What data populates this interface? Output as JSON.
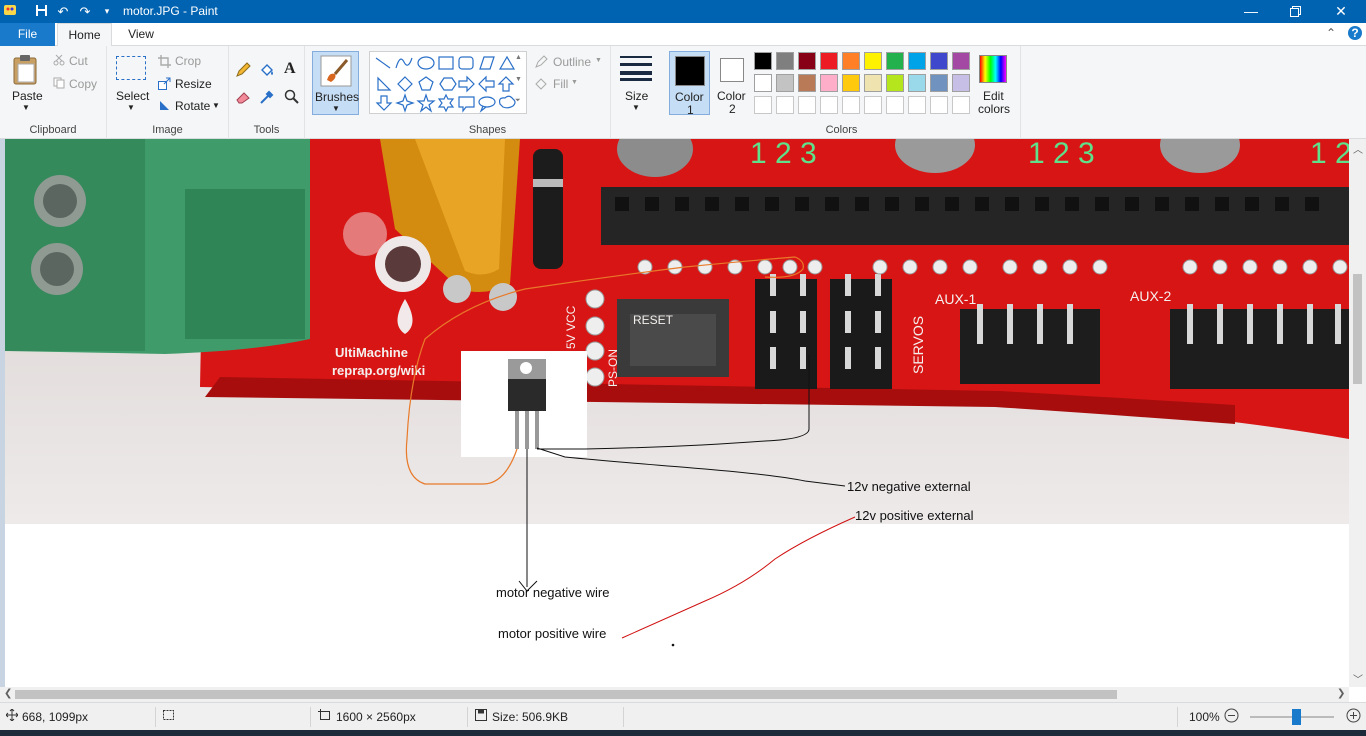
{
  "app": {
    "window_title": "motor.JPG - Paint"
  },
  "quick_access": [
    "save-icon",
    "undo-icon",
    "redo-icon",
    "customize-icon"
  ],
  "tabs": [
    {
      "label": "File"
    },
    {
      "label": "Home"
    },
    {
      "label": "View"
    }
  ],
  "ribbon": {
    "clipboard": {
      "group_label": "Clipboard",
      "paste": "Paste",
      "cut": "Cut",
      "copy": "Copy"
    },
    "image": {
      "group_label": "Image",
      "select": "Select",
      "crop": "Crop",
      "resize": "Resize",
      "rotate": "Rotate"
    },
    "tools": {
      "group_label": "Tools"
    },
    "brushes": {
      "label": "Brushes"
    },
    "shapes": {
      "group_label": "Shapes",
      "outline": "Outline",
      "fill": "Fill"
    },
    "size": {
      "label": "Size"
    },
    "colors": {
      "group_label": "Colors",
      "color1_line1": "Color",
      "color1_line2": "1",
      "color2_line1": "Color",
      "color2_line2": "2",
      "edit_line1": "Edit",
      "edit_line2": "colors",
      "palette_row1": [
        "#000000",
        "#7f7f7f",
        "#880015",
        "#ed1c24",
        "#ff7f27",
        "#fff200",
        "#22b14c",
        "#00a2e8",
        "#3f48cc",
        "#a349a4"
      ],
      "palette_row2": [
        "#ffffff",
        "#c3c3c3",
        "#b97a57",
        "#ffaec9",
        "#ffc90e",
        "#efe4b0",
        "#b5e61d",
        "#99d9ea",
        "#7092be",
        "#c8bfe7"
      ],
      "color1": "#000000",
      "color2": "#ffffff"
    }
  },
  "canvas": {
    "annotations": {
      "neg_external": "12v negative external",
      "pos_external": "12v positive external",
      "motor_neg": "motor negative wire",
      "motor_pos": "motor positive wire"
    },
    "board_labels": {
      "nums": "1 2 3",
      "ultimachine": "UltiMachine",
      "reprap": "reprap.org/wiki",
      "reset": "RESET",
      "servos": "SERVOS",
      "aux1": "AUX-1",
      "aux2": "AUX-2",
      "vcc": "5V VCC",
      "ps_on": "PS-ON"
    }
  },
  "status": {
    "cursor_pos": "668, 1099px",
    "dimensions": "1600 × 2560px",
    "size": "Size: 506.9KB",
    "zoom": "100%",
    "zoom_level": 0.55
  }
}
